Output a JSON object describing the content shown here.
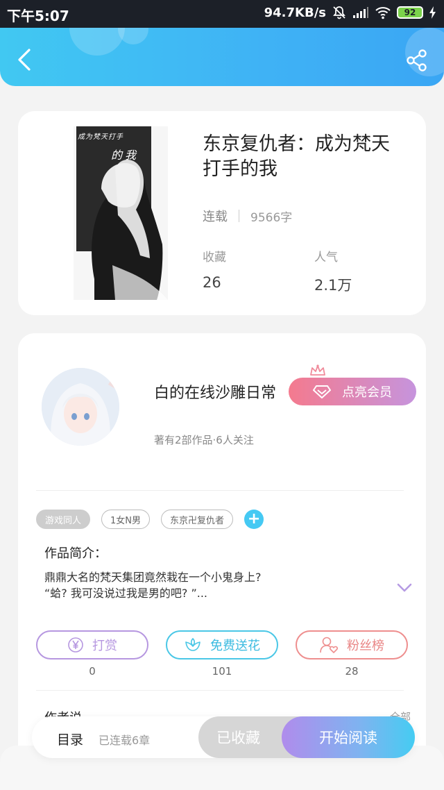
{
  "status_bar": {
    "time": "下午5:07",
    "speed": "94.7KB/s",
    "battery": "92"
  },
  "header": {
    "back_icon": "chevron-left-icon",
    "share_icon": "share-icon"
  },
  "book": {
    "title": "东京复仇者：成为梵天打手的我",
    "cover_text_top": "成为梵天打手",
    "cover_text_bottom": "的我",
    "status": "连载",
    "word_count": "9566字",
    "favorites_label": "收藏",
    "favorites_value": "26",
    "popularity_label": "人气",
    "popularity_value": "2.1万"
  },
  "author": {
    "name": "白的在线沙雕日常",
    "vip_label": "点亮会员",
    "subtitle": "著有2部作品·6人关注"
  },
  "tags": [
    {
      "label": "游戏同人",
      "active": true
    },
    {
      "label": "1女N男",
      "active": false
    },
    {
      "label": "东京卍复仇者",
      "active": false
    }
  ],
  "intro": {
    "title": "作品简介：",
    "line1": "鼎鼎大名的梵天集团竟然栽在一个小鬼身上?",
    "line2": "“蛤? 我可没说过我是男的吧? ”..."
  },
  "actions": [
    {
      "label": "打赏",
      "count": "0",
      "color": "#b697e0",
      "icon": "yen-icon"
    },
    {
      "label": "免费送花",
      "count": "101",
      "color": "#4ac7e6",
      "icon": "flower-icon"
    },
    {
      "label": "粉丝榜",
      "count": "28",
      "color": "#ee8e8e",
      "icon": "fan-icon"
    }
  ],
  "author_says": {
    "title": "作者说",
    "more": "全部"
  },
  "bottom_bar": {
    "toc_label": "目录",
    "toc_sub": "已连载6章",
    "favorited_label": "已收藏",
    "read_label": "开始阅读"
  },
  "colors": {
    "header": "#3fb2f5",
    "accent": "#45c9f3",
    "vip_start": "#f47a8e",
    "vip_end": "#c694dd"
  }
}
